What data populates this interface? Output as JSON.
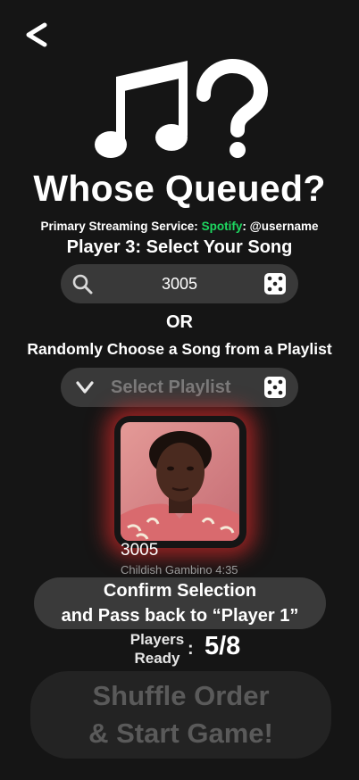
{
  "app": {
    "title": "Whose Queued?"
  },
  "streaming": {
    "label": "Primary Streaming Service:",
    "service": "Spotify",
    "username": ": @username"
  },
  "player_heading": "Player 3: Select Your Song",
  "search": {
    "value": "3005"
  },
  "or_label": "OR",
  "random_label": "Randomly Choose a Song from a Playlist",
  "playlist": {
    "placeholder": "Select Playlist"
  },
  "selected_song": {
    "title": "3005",
    "artist": "Childish Gambino",
    "duration": "4:35"
  },
  "confirm_button": {
    "line1": "Confirm Selection",
    "line2": "and Pass back to “Player 1”"
  },
  "players_ready": {
    "label_line1": "Players",
    "label_line2": "Ready",
    "separator": ":",
    "count": "5/8"
  },
  "shuffle_button": {
    "line1": "Shuffle Order",
    "line2": "& Start Game!"
  },
  "colors": {
    "background": "#151515",
    "spotify_green": "#1ed760",
    "pill": "#393939",
    "glow": "#ff2d2d",
    "disabled_text": "#5a5a5a"
  },
  "icons": [
    "back-arrow-icon",
    "music-question-logo",
    "search-icon",
    "dice-icon",
    "chevron-down-icon",
    "album-art"
  ]
}
